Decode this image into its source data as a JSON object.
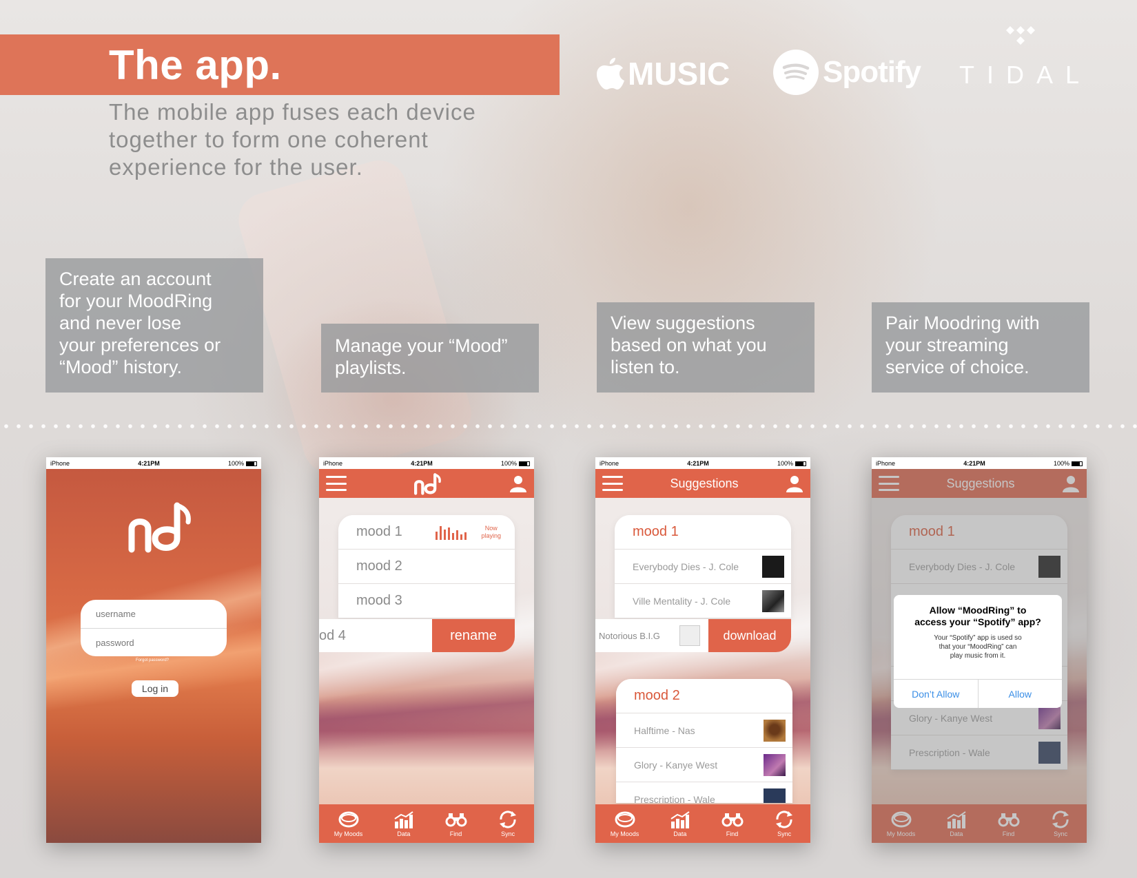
{
  "header": {
    "title": "The app.",
    "subtitle": "The mobile app fuses each device together to form one coherent experience for the user."
  },
  "logos": {
    "apple_music": "MUSIC",
    "spotify": "Spotify",
    "tidal": "TIDAL"
  },
  "captions": [
    "Create an account\nfor your MoodRing\nand never lose\nyour preferences or\n“Mood” history.",
    "Manage your “Mood”\nplaylists.",
    "View suggestions\nbased on what you\nlisten to.",
    "Pair Moodring with\nyour streaming\nservice of choice."
  ],
  "status_bar": {
    "carrier": "iPhone",
    "time": "4:21PM",
    "battery": "100%"
  },
  "login": {
    "username_placeholder": "username",
    "password_placeholder": "password",
    "forgot": "Forgot password?",
    "login_button": "Log in"
  },
  "moods_screen": {
    "moods": [
      "mood 1",
      "mood 2",
      "mood 3"
    ],
    "swiped_mood": "od 4",
    "now_playing": "Now\nplaying",
    "rename_action": "rename"
  },
  "suggestions_screen": {
    "title": "Suggestions",
    "groups": [
      {
        "name": "mood 1",
        "songs": [
          "Everybody Dies  -  J. Cole",
          "Ville Mentality  -  J. Cole"
        ],
        "swiped_song": "Notorious B.I.G",
        "action": "download"
      },
      {
        "name": "mood 2",
        "songs": [
          "Halftime  -  Nas",
          "Glory  -  Kanye West",
          "Prescription  -  Wale"
        ]
      }
    ]
  },
  "dialog": {
    "title": "Allow “MoodRing” to\naccess your “Spotify” app?",
    "message": "Your “Spotify” app is used so\nthat your “MoodRing” can\nplay music from it.",
    "deny": "Don’t Allow",
    "allow": "Allow"
  },
  "tabbar": [
    "My Moods",
    "Data",
    "Find",
    "Sync"
  ],
  "colors": {
    "accent": "#e0644a",
    "title_bar": "#de7458",
    "caption_bg": "#96989b",
    "dialog_link": "#3a8ee6"
  }
}
